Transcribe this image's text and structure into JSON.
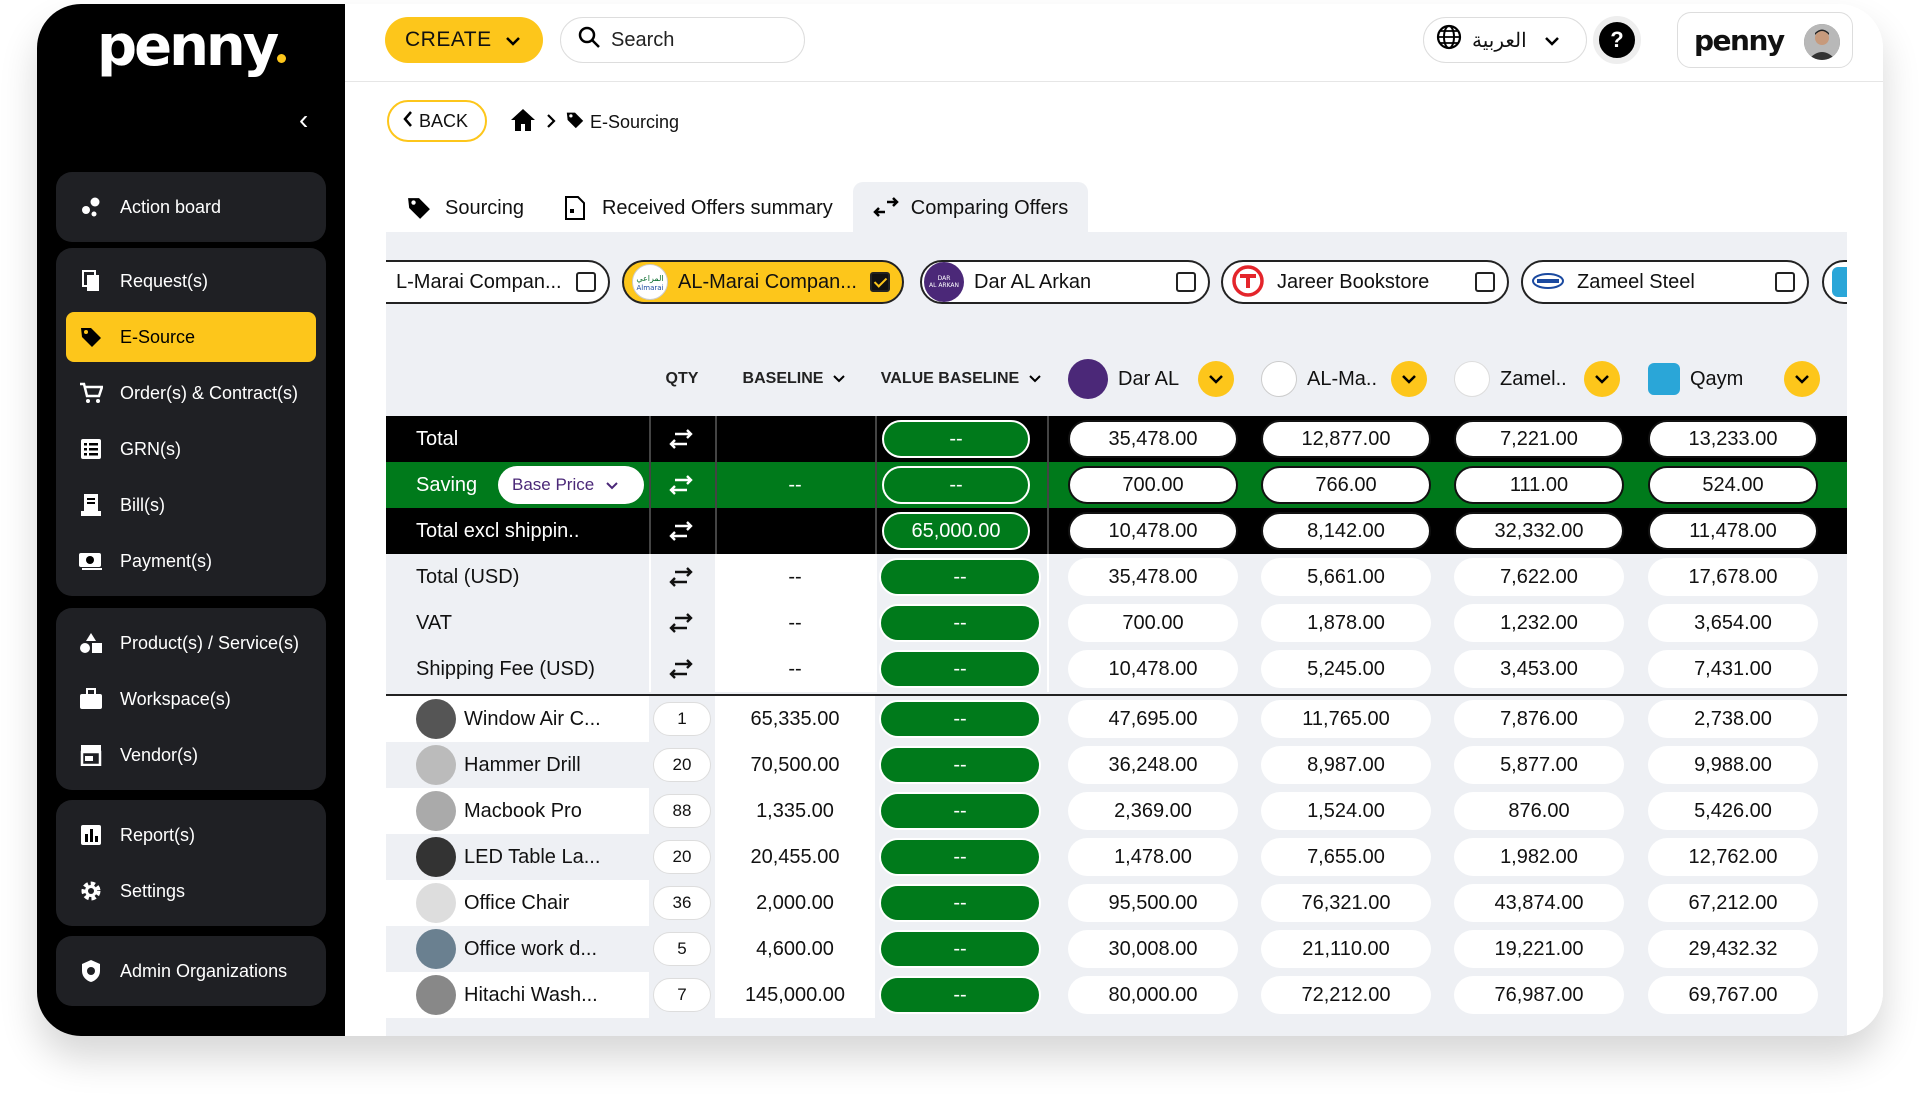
{
  "brand": {
    "logo_text": "penny",
    "user_logo": "penny"
  },
  "topbar": {
    "create_label": "CREATE",
    "search_label": "Search",
    "language_label": "العربية"
  },
  "sidebar": {
    "groups": [
      [
        {
          "label": "Action board",
          "icon": "action-board-icon"
        }
      ],
      [
        {
          "label": "Request(s)",
          "icon": "request-icon"
        },
        {
          "label": "E-Source",
          "icon": "tag-icon",
          "active": true
        },
        {
          "label": "Order(s) & Contract(s)",
          "icon": "cart-icon"
        },
        {
          "label": "GRN(s)",
          "icon": "list-icon"
        },
        {
          "label": "Bill(s)",
          "icon": "bill-icon"
        },
        {
          "label": "Payment(s)",
          "icon": "payment-icon"
        }
      ],
      [
        {
          "label": "Product(s) / Service(s)",
          "icon": "shapes-icon"
        },
        {
          "label": "Workspace(s)",
          "icon": "briefcase-icon"
        },
        {
          "label": "Vendor(s)",
          "icon": "store-icon"
        }
      ],
      [
        {
          "label": "Report(s)",
          "icon": "report-icon"
        },
        {
          "label": "Settings",
          "icon": "gear-icon"
        }
      ],
      [
        {
          "label": "Admin Organizations",
          "icon": "admin-icon"
        }
      ]
    ]
  },
  "breadcrumb": {
    "back_label": "BACK",
    "current": "E-Sourcing"
  },
  "tabs": [
    {
      "label": "Sourcing",
      "icon": "tag-icon"
    },
    {
      "label": "Received Offers summary",
      "icon": "document-icon"
    },
    {
      "label": "Comparing Offers",
      "icon": "compare-icon",
      "active": true
    }
  ],
  "vendor_chips": [
    {
      "label": "L-Marai Compan...",
      "checked": false
    },
    {
      "label": "AL-Marai Compan...",
      "checked": true
    },
    {
      "label": "Dar AL Arkan",
      "checked": false
    },
    {
      "label": "Jareer Bookstore",
      "checked": false
    },
    {
      "label": "Zameel Steel",
      "checked": false
    }
  ],
  "table": {
    "headers": {
      "qty": "QTY",
      "baseline": "BASELINE",
      "value_baseline": "VALUE BASELINE"
    },
    "vendors": [
      "Dar AL",
      "AL-Ma..",
      "Zamel..",
      "Qaym"
    ],
    "summary_rows": [
      {
        "label": "Total",
        "baseline": "",
        "value_baseline": "--",
        "values": [
          "35,478.00",
          "12,877.00",
          "7,221.00",
          "13,233.00"
        ],
        "style": "black"
      },
      {
        "label": "Saving",
        "dropdown": "Base Price",
        "baseline": "--",
        "value_baseline": "--",
        "values": [
          "700.00",
          "766.00",
          "111.00",
          "524.00"
        ],
        "style": "green"
      },
      {
        "label": "Total  excl shippin..",
        "baseline": "",
        "value_baseline": "65,000.00",
        "values": [
          "10,478.00",
          "8,142.00",
          "32,332.00",
          "11,478.00"
        ],
        "style": "black"
      },
      {
        "label": "Total (USD)",
        "baseline": "--",
        "value_baseline": "--",
        "values": [
          "35,478.00",
          "5,661.00",
          "7,622.00",
          "17,678.00"
        ],
        "style": "light"
      },
      {
        "label": "VAT",
        "baseline": "--",
        "value_baseline": "--",
        "values": [
          "700.00",
          "1,878.00",
          "1,232.00",
          "3,654.00"
        ],
        "style": "light"
      },
      {
        "label": "Shipping Fee (USD)",
        "baseline": "--",
        "value_baseline": "--",
        "values": [
          "10,478.00",
          "5,245.00",
          "3,453.00",
          "7,431.00"
        ],
        "style": "light"
      }
    ],
    "product_rows": [
      {
        "label": "Window Air C...",
        "qty": "1",
        "baseline": "65,335.00",
        "value_baseline": "--",
        "values": [
          "47,695.00",
          "11,765.00",
          "7,876.00",
          "2,738.00"
        ]
      },
      {
        "label": "Hammer Drill",
        "qty": "20",
        "baseline": "70,500.00",
        "value_baseline": "--",
        "values": [
          "36,248.00",
          "8,987.00",
          "5,877.00",
          "9,988.00"
        ]
      },
      {
        "label": "Macbook Pro",
        "qty": "88",
        "baseline": "1,335.00",
        "value_baseline": "--",
        "values": [
          "2,369.00",
          "1,524.00",
          "876.00",
          "5,426.00"
        ]
      },
      {
        "label": "LED Table La...",
        "qty": "20",
        "baseline": "20,455.00",
        "value_baseline": "--",
        "values": [
          "1,478.00",
          "7,655.00",
          "1,982.00",
          "12,762.00"
        ]
      },
      {
        "label": "Office Chair",
        "qty": "36",
        "baseline": "2,000.00",
        "value_baseline": "--",
        "values": [
          "95,500.00",
          "76,321.00",
          "43,874.00",
          "67,212.00"
        ]
      },
      {
        "label": "Office work d...",
        "qty": "5",
        "baseline": "4,600.00",
        "value_baseline": "--",
        "values": [
          "30,008.00",
          "21,110.00",
          "19,221.00",
          "29,432.32"
        ]
      },
      {
        "label": "Hitachi Wash...",
        "qty": "7",
        "baseline": "145,000.00",
        "value_baseline": "--",
        "values": [
          "80,000.00",
          "72,212.00",
          "76,987.00",
          "69,767.00"
        ]
      }
    ]
  },
  "colors": {
    "brand_yellow": "#fdc61b",
    "green": "#007a1b",
    "black": "#000000",
    "panel": "#eef0f4"
  }
}
